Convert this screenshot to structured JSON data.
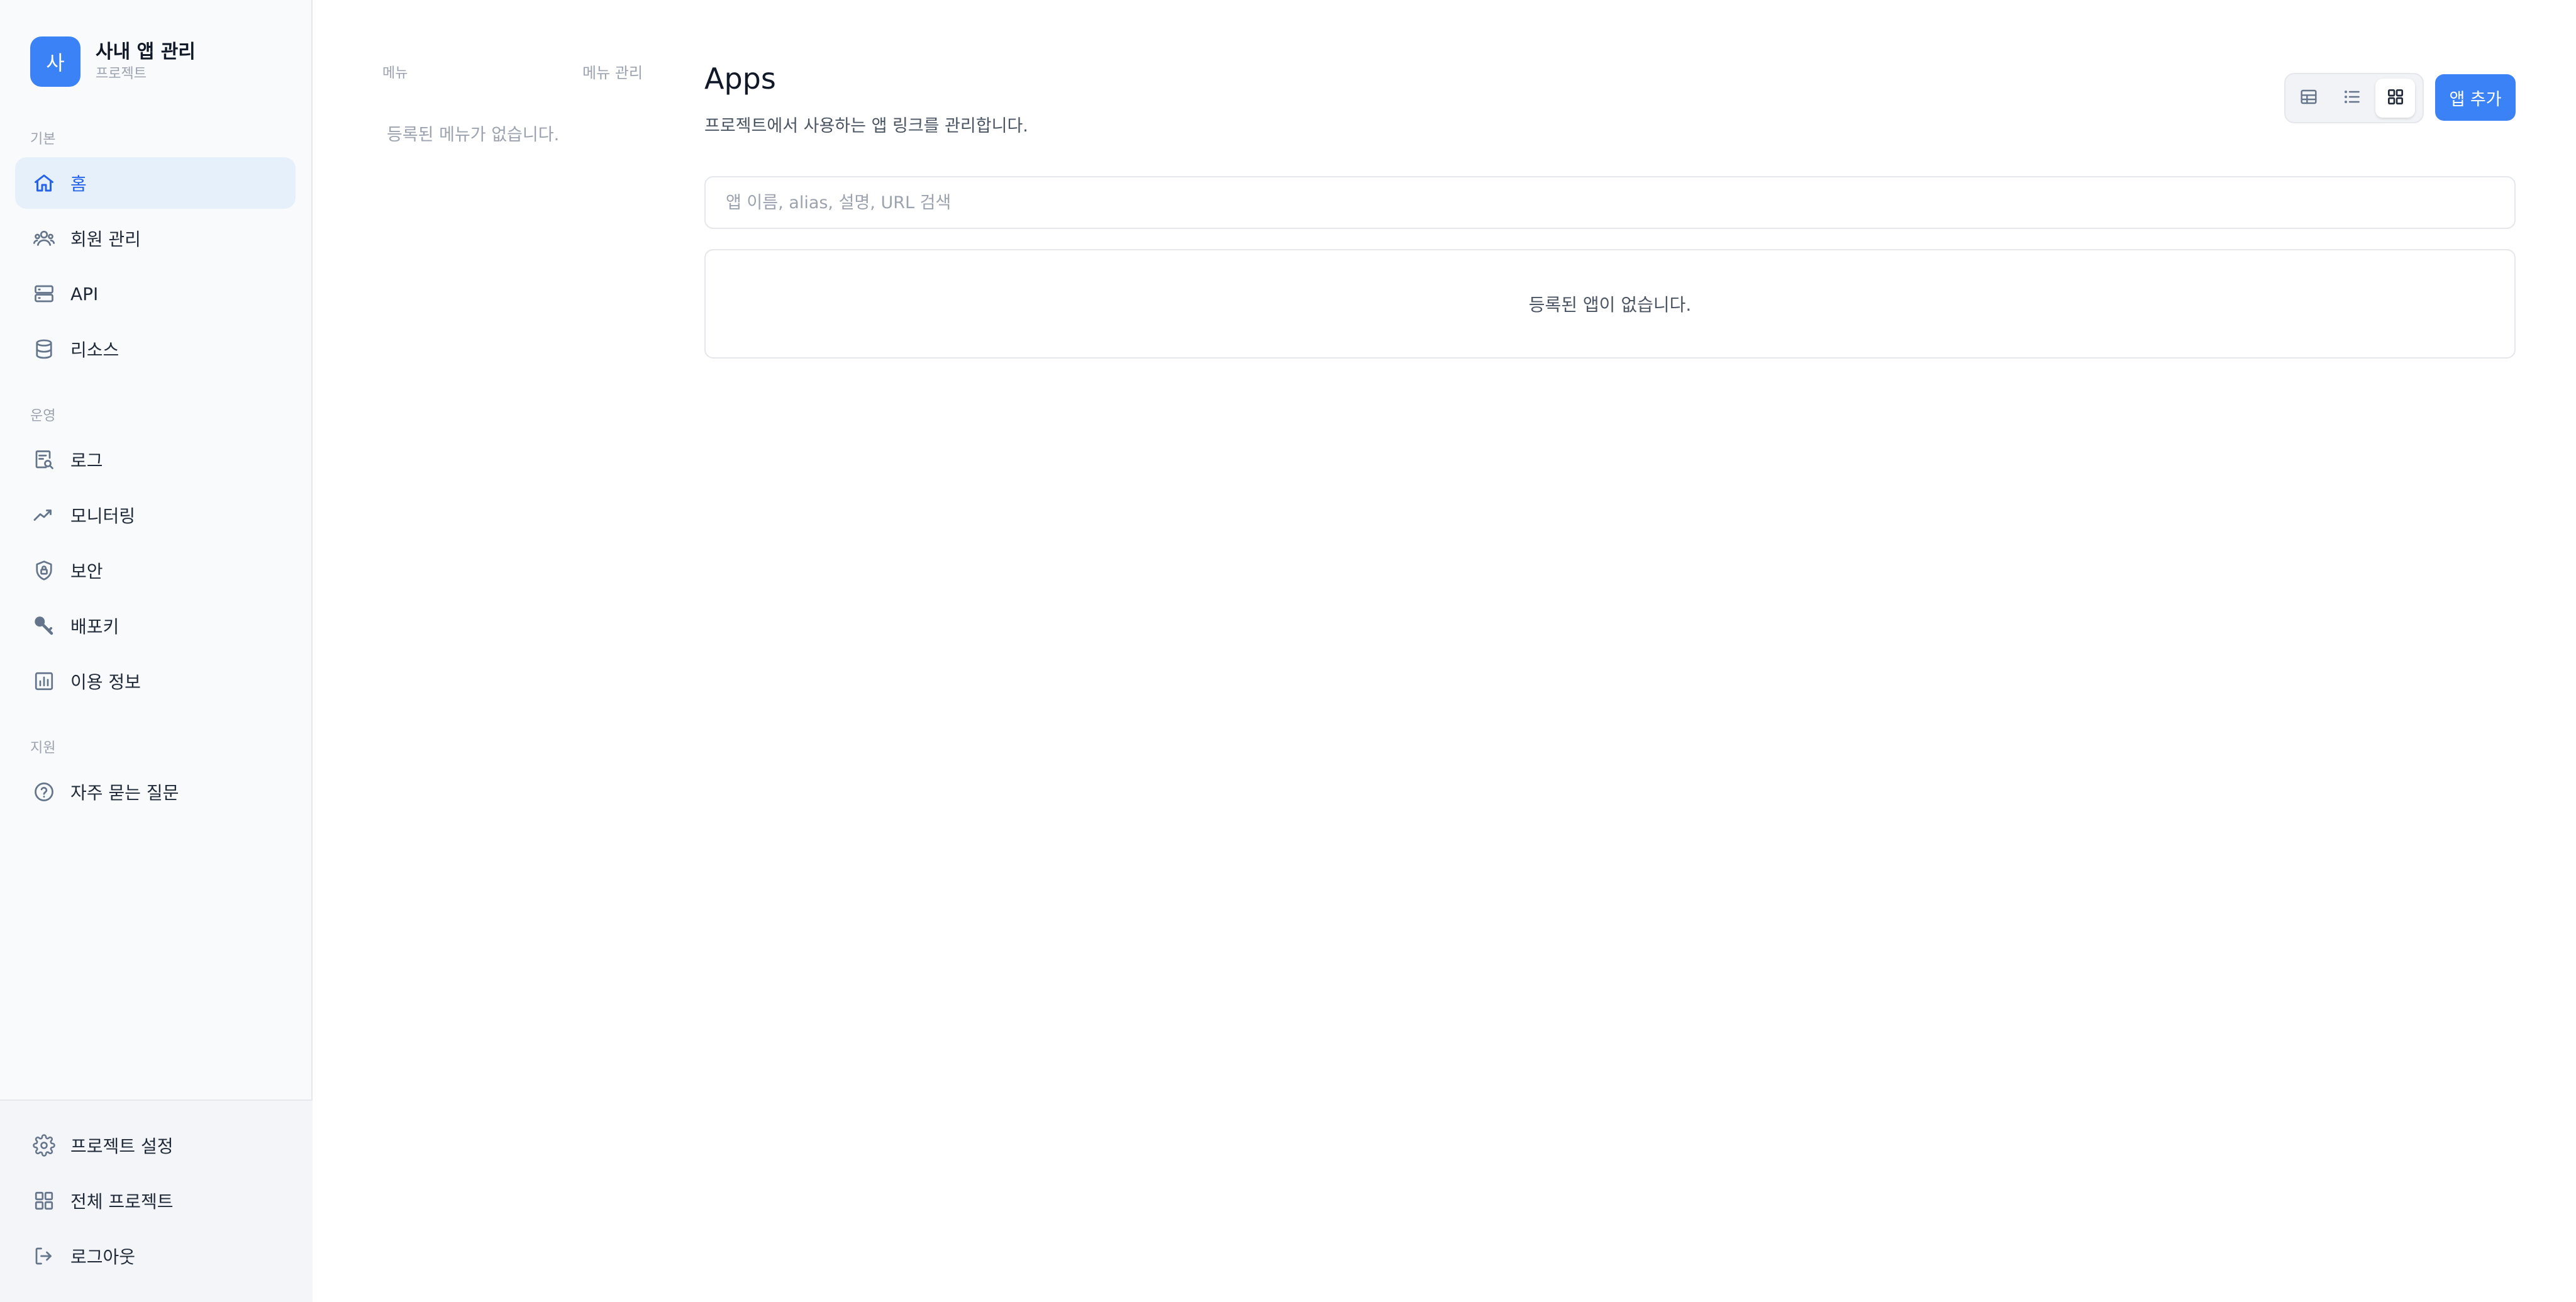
{
  "brand": {
    "logo_letter": "사",
    "name": "사내 앱 관리",
    "subtitle": "프로젝트"
  },
  "sidebar": {
    "sections": [
      {
        "label": "기본",
        "items": [
          {
            "label": "홈",
            "icon": "home-icon",
            "active": true
          },
          {
            "label": "회원 관리",
            "icon": "users-icon"
          },
          {
            "label": "API",
            "icon": "server-icon"
          },
          {
            "label": "리소스",
            "icon": "database-icon"
          }
        ]
      },
      {
        "label": "운영",
        "items": [
          {
            "label": "로그",
            "icon": "log-search-icon"
          },
          {
            "label": "모니터링",
            "icon": "trend-line-icon"
          },
          {
            "label": "보안",
            "icon": "shield-lock-icon"
          },
          {
            "label": "배포키",
            "icon": "key-icon"
          },
          {
            "label": "이용 정보",
            "icon": "bar-chart-icon"
          }
        ]
      },
      {
        "label": "지원",
        "items": [
          {
            "label": "자주 묻는 질문",
            "icon": "help-circle-icon"
          }
        ]
      }
    ],
    "bottom_items": [
      {
        "label": "프로젝트 설정",
        "icon": "gear-icon"
      },
      {
        "label": "전체 프로젝트",
        "icon": "grid-icon"
      },
      {
        "label": "로그아웃",
        "icon": "logout-icon"
      }
    ]
  },
  "menu_panel": {
    "title": "메뉴",
    "manage_label": "메뉴 관리",
    "empty_text": "등록된 메뉴가 없습니다."
  },
  "main": {
    "title": "Apps",
    "description": "프로젝트에서 사용하는 앱 링크를 관리합니다.",
    "view_modes": [
      "table",
      "list",
      "grid"
    ],
    "active_view": "grid",
    "add_button_label": "앱 추가",
    "search_placeholder": "앱 이름, alias, 설명, URL 검색",
    "search_value": "",
    "empty_text": "등록된 앱이 없습니다."
  },
  "colors": {
    "accent": "#3b82f6",
    "active_bg": "#e6f0fb",
    "sidebar_bg": "#f8fafc"
  }
}
